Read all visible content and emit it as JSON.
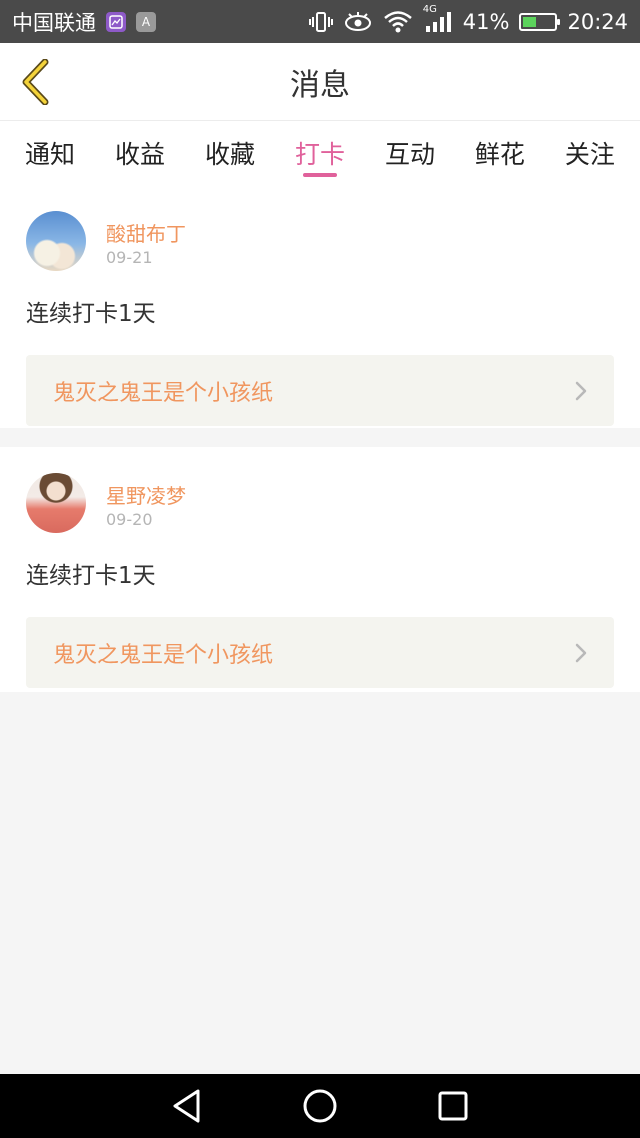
{
  "status_bar": {
    "carrier": "中国联通",
    "network": "4G",
    "battery": "41%",
    "time": "20:24",
    "battery_level": 0.41,
    "icons": [
      "gallery-app-icon",
      "keyboard-app-icon",
      "vibrate-icon",
      "eye-icon",
      "wifi-icon",
      "signal-icon",
      "battery-icon"
    ]
  },
  "header": {
    "title": "消息",
    "back_icon": "chevron-left-icon"
  },
  "tabs": [
    {
      "label": "通知",
      "active": false
    },
    {
      "label": "收益",
      "active": false
    },
    {
      "label": "收藏",
      "active": false
    },
    {
      "label": "打卡",
      "active": true
    },
    {
      "label": "互动",
      "active": false
    },
    {
      "label": "鲜花",
      "active": false
    },
    {
      "label": "关注",
      "active": false
    }
  ],
  "messages": [
    {
      "username": "酸甜布丁",
      "date": "09-21",
      "text": "连续打卡1天",
      "link": "鬼灭之鬼王是个小孩纸"
    },
    {
      "username": "星野凌梦",
      "date": "09-20",
      "text": "连续打卡1天",
      "link": "鬼灭之鬼王是个小孩纸"
    }
  ],
  "colors": {
    "accent_pink": "#e0619b",
    "accent_orange": "#f0965f",
    "status_bar_bg": "#4a4a4a",
    "page_bg": "#f5f5f5"
  }
}
